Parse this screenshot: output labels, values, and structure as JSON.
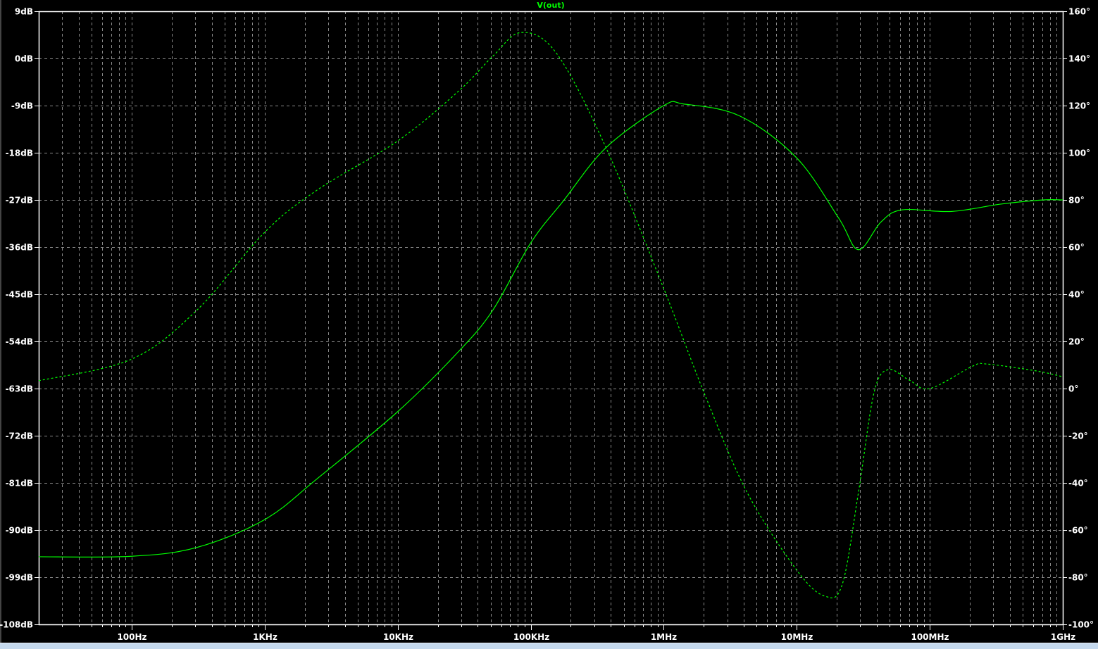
{
  "chart_data": {
    "type": "line",
    "title": "V(out)",
    "xscale": "log",
    "xlim_hz": [
      20,
      1000000000
    ],
    "ylim_left_db": [
      -108,
      9
    ],
    "ylim_right_deg": [
      -100,
      160
    ],
    "grid": true,
    "left_ticks": [
      "9dB",
      "0dB",
      "-9dB",
      "-18dB",
      "-27dB",
      "-36dB",
      "-45dB",
      "-54dB",
      "-63dB",
      "-72dB",
      "-81dB",
      "-90dB",
      "-99dB",
      "-108dB"
    ],
    "left_tick_values": [
      9,
      0,
      -9,
      -18,
      -27,
      -36,
      -45,
      -54,
      -63,
      -72,
      -81,
      -90,
      -99,
      -108
    ],
    "right_ticks": [
      "160°",
      "140°",
      "120°",
      "100°",
      "80°",
      "60°",
      "40°",
      "20°",
      "0°",
      "-20°",
      "-40°",
      "-60°",
      "-80°",
      "-100°"
    ],
    "right_tick_values": [
      160,
      140,
      120,
      100,
      80,
      60,
      40,
      20,
      0,
      -20,
      -40,
      -60,
      -80,
      -100
    ],
    "x_ticks": [
      "100Hz",
      "1KHz",
      "10KHz",
      "100KHz",
      "1MHz",
      "10MHz",
      "100MHz",
      "1GHz"
    ],
    "x_tick_values": [
      100,
      1000,
      10000,
      100000,
      1000000,
      10000000,
      100000000,
      1000000000
    ],
    "series": [
      {
        "name": "V(out) magnitude",
        "axis": "left",
        "style": "solid",
        "color": "#00ff00",
        "x": [
          20,
          100,
          311,
          1000,
          2480,
          10000,
          28500,
          52000,
          100000,
          177000,
          369000,
          1000000,
          1410000,
          3740000,
          10000000,
          20700000,
          29100000,
          43000000,
          62000000,
          146000000,
          342000000,
          711000000,
          1000000000
        ],
        "y": [
          -95.1,
          -95,
          -93.3,
          -88,
          -80.2,
          -67.4,
          -56,
          -48,
          -35.2,
          -27.1,
          -17,
          -9,
          -8.7,
          -11,
          -19,
          -30.5,
          -36.5,
          -31.2,
          -28.9,
          -29.2,
          -27.8,
          -27,
          -27
        ]
      },
      {
        "name": "V(out) phase",
        "axis": "right",
        "style": "dashed",
        "color": "#00ff00",
        "x": [
          20,
          100,
          311,
          1000,
          2480,
          10000,
          28500,
          52000,
          85000,
          157000,
          369000,
          1000000,
          2030000,
          4230000,
          10000000,
          16200000,
          22000000,
          29100000,
          38000000,
          48500000,
          70000000,
          100000000,
          210000000,
          268000000,
          630000000,
          1000000000
        ],
        "y": [
          3.3,
          12.5,
          33.4,
          66.3,
          84.2,
          105,
          126,
          141,
          151,
          142,
          102,
          42.4,
          -2.4,
          -44,
          -77,
          -88,
          -83,
          -44,
          -2,
          8,
          3.6,
          0,
          9.5,
          10.4,
          7.5,
          5
        ]
      }
    ]
  }
}
